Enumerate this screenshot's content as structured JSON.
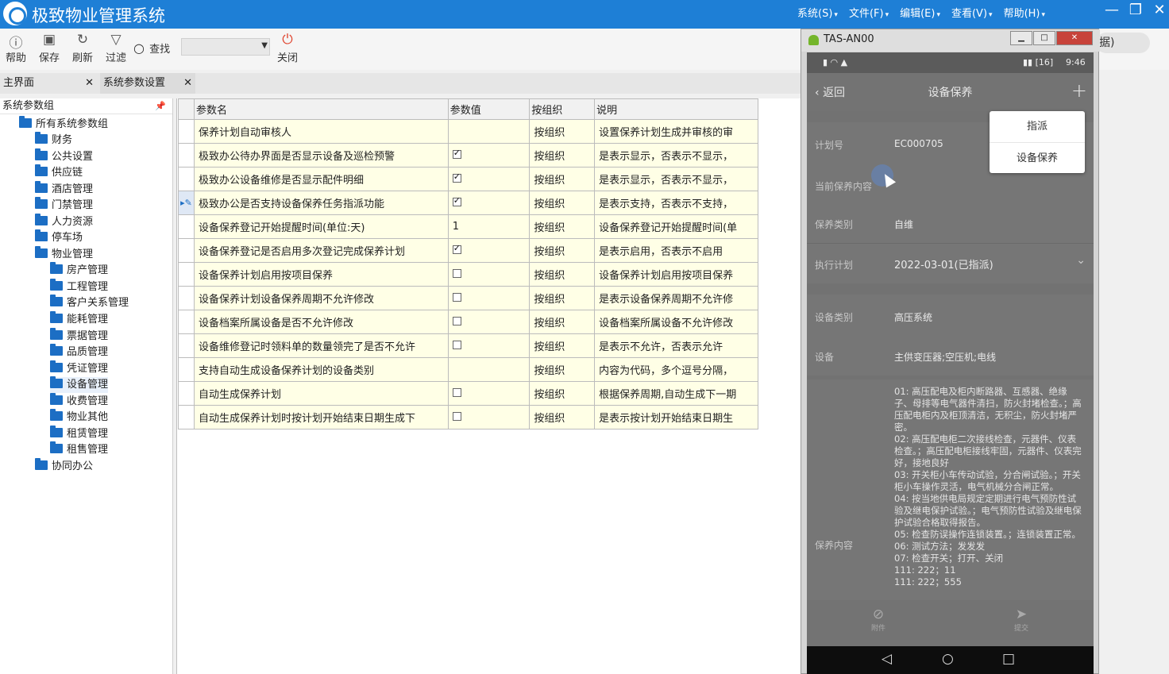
{
  "app": {
    "title": "极致物业管理系统",
    "menu": [
      "系统(S)",
      "文件(F)",
      "编辑(E)",
      "查看(V)",
      "帮助(H)"
    ]
  },
  "toolbar": {
    "help": "帮助",
    "save": "保存",
    "refresh": "刷新",
    "filter": "过滤",
    "find": "查找",
    "close": "关闭"
  },
  "tabs": [
    {
      "label": "主界面"
    },
    {
      "label": "系统参数设置"
    }
  ],
  "tree": {
    "header": "系统参数组",
    "root": "所有系统参数组",
    "groups": [
      "财务",
      "公共设置",
      "供应链",
      "酒店管理",
      "门禁管理",
      "人力资源",
      "停车场",
      "物业管理"
    ],
    "property_children": [
      "房产管理",
      "工程管理",
      "客户关系管理",
      "能耗管理",
      "票据管理",
      "品质管理",
      "凭证管理",
      "设备管理",
      "收费管理",
      "物业其他",
      "租赁管理",
      "租售管理"
    ],
    "last": "协同办公",
    "selected": "设备管理"
  },
  "grid": {
    "columns": [
      "参数名",
      "参数值",
      "按组织",
      "说明"
    ],
    "rows": [
      {
        "name": "保养计划自动审核人",
        "value": "",
        "check": null,
        "org": "按组织",
        "desc": "设置保养计划生成并审核的审"
      },
      {
        "name": "极致办公待办界面是否显示设备及巡检预警",
        "value": "",
        "check": true,
        "org": "按组织",
        "desc": "是表示显示，否表示不显示，"
      },
      {
        "name": "极致办公设备维修是否显示配件明细",
        "value": "",
        "check": true,
        "org": "按组织",
        "desc": "是表示显示，否表示不显示，"
      },
      {
        "name": "极致办公是否支持设备保养任务指派功能",
        "value": "",
        "check": true,
        "org": "按组织",
        "desc": "是表示支持，否表示不支持，"
      },
      {
        "name": "设备保养登记开始提醒时间(单位:天)",
        "value": "1",
        "check": null,
        "org": "按组织",
        "desc": "设备保养登记开始提醒时间(单"
      },
      {
        "name": "设备保养登记是否启用多次登记完成保养计划",
        "value": "",
        "check": true,
        "org": "按组织",
        "desc": "是表示启用，否表示不启用"
      },
      {
        "name": "设备保养计划启用按项目保养",
        "value": "",
        "check": false,
        "org": "按组织",
        "desc": "设备保养计划启用按项目保养"
      },
      {
        "name": "设备保养计划设备保养周期不允许修改",
        "value": "",
        "check": false,
        "org": "按组织",
        "desc": "是表示设备保养周期不允许修"
      },
      {
        "name": "设备档案所属设备是否不允许修改",
        "value": "",
        "check": false,
        "org": "按组织",
        "desc": "设备档案所属设备不允许修改"
      },
      {
        "name": "设备维修登记时领料单的数量领完了是否不允许",
        "value": "",
        "check": false,
        "org": "按组织",
        "desc": "是表示不允许，否表示允许"
      },
      {
        "name": "支持自动生成设备保养计划的设备类别",
        "value": "",
        "check": null,
        "org": "按组织",
        "desc": "内容为代码，多个逗号分隔，"
      },
      {
        "name": "自动生成保养计划",
        "value": "",
        "check": false,
        "org": "按组织",
        "desc": "根据保养周期,自动生成下一期"
      },
      {
        "name": "自动生成保养计划时按计划开始结束日期生成下",
        "value": "",
        "check": false,
        "org": "按组织",
        "desc": "是表示按计划开始结束日期生"
      }
    ]
  },
  "emulator": {
    "window_title": "TAS-AN00",
    "status_time": "9:46",
    "status_battery": "16",
    "nav_back": "返回",
    "nav_title": "设备保养",
    "popup": [
      "指派",
      "设备保养"
    ],
    "fields": [
      {
        "label": "计划号",
        "value": "EC000705"
      },
      {
        "label": "当前保养内容",
        "value": ""
      },
      {
        "label": "保养类别",
        "value": "自维"
      },
      {
        "label": "执行计划",
        "value": "2022-03-01(已指派)"
      },
      {
        "label": "设备类别",
        "value": "高压系统"
      },
      {
        "label": "设备",
        "value": "主供变压器;空压机;电线"
      },
      {
        "label": "保养内容",
        "value": ""
      }
    ],
    "content_lines": [
      "01: 高压配电及柜内断路器、互感器、绝缘子、母排等电气器件清扫，防火封堵检查。；高压配电柜内及柜顶清洁，无积尘，防火封堵严密。",
      "02: 高压配电柜二次接线检查，元器件、仪表检查。；高压配电柜接线牢固，元器件、仪表完好，接地良好",
      "03: 开关柜小车传动试验，分合闸试验。；开关柜小车操作灵活，电气机械分合闸正常。",
      "04: 按当地供电局规定定期进行电气预防性试验及继电保护试验。；电气预防性试验及继电保护试验合格取得报告。",
      "05: 检查防误操作连锁装置。；连锁装置正常。",
      "06: 测试方法；发发发",
      "07: 检查开关；打开、关闭",
      "111: 222；11",
      "111: 222；555"
    ],
    "bottom": [
      "附件",
      "提交"
    ]
  },
  "right_pill": "据)"
}
